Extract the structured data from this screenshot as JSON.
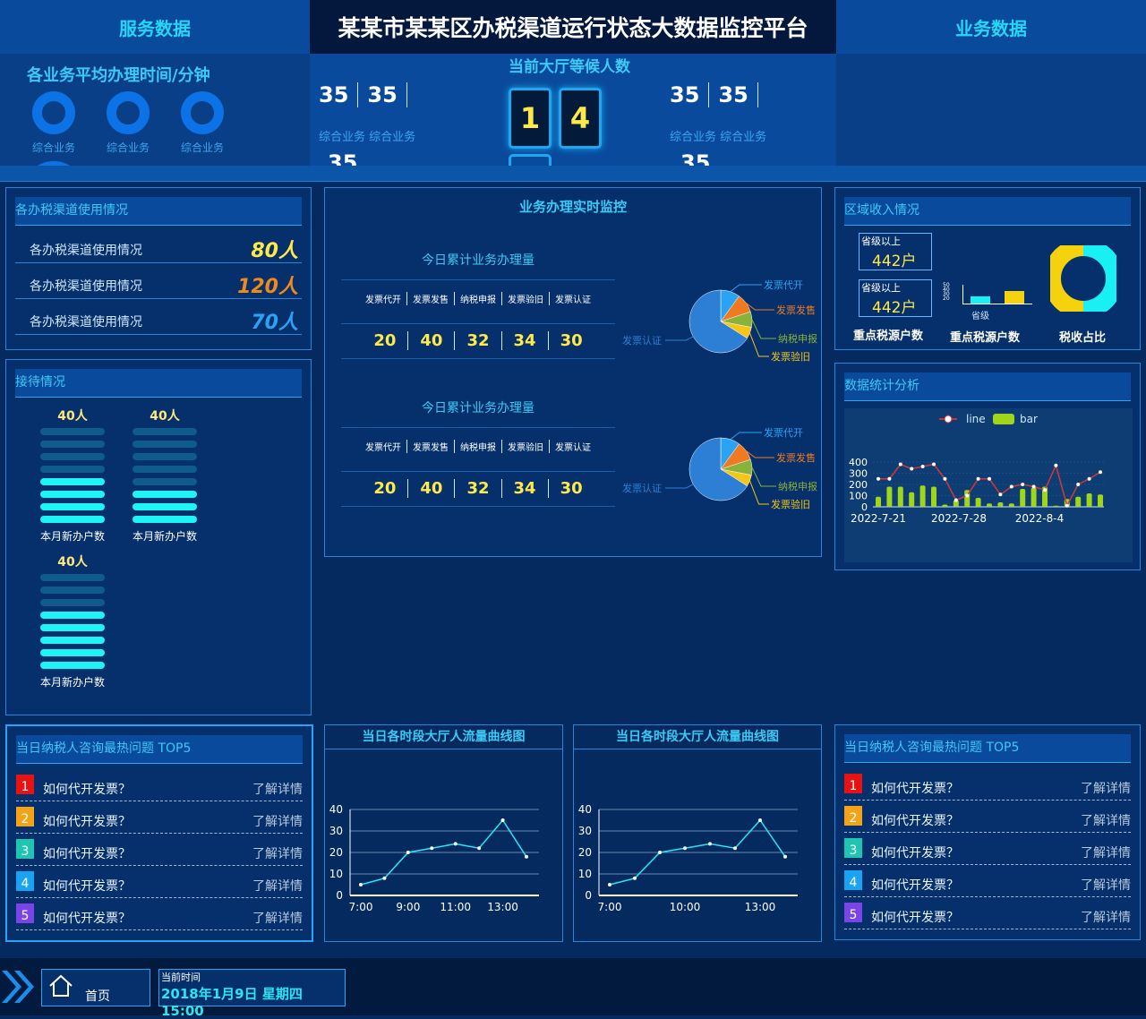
{
  "header": {
    "left": "服务数据",
    "center": "某某市某某区办税渠道运行状态大数据监控平台",
    "right": "业务数据"
  },
  "topband": {
    "avg_title": "各业务平均办理时间/分钟",
    "ring_labels": [
      "综合业务",
      "综合业务",
      "综合业务"
    ],
    "wait_title": "当前大厅等候人数",
    "wait_digits": [
      "1",
      "4"
    ],
    "left_nums": [
      "35",
      "35"
    ],
    "right_nums": [
      "35",
      "35"
    ],
    "left_labels": "综合业务 综合业务",
    "right_labels": "综合业务 综合业务",
    "left_partial": "35",
    "right_partial": "35"
  },
  "channel": {
    "title": "各办税渠道使用情况",
    "rows": [
      {
        "label": "各办税渠道使用情况",
        "value": "80人",
        "color": "#ffe84a"
      },
      {
        "label": "各办税渠道使用情况",
        "value": "120人",
        "color": "#f08a1c"
      },
      {
        "label": "各办税渠道使用情况",
        "value": "70人",
        "color": "#2aa3f5"
      }
    ]
  },
  "reception": {
    "title": "接待情况",
    "items": [
      {
        "count": "40人",
        "label": "本月新办户数",
        "level": 0.5
      },
      {
        "count": "40人",
        "label": "本月新办户数",
        "level": 0.375
      },
      {
        "count": "40人",
        "label": "本月新办户数",
        "level": 0.625
      }
    ]
  },
  "monitor": {
    "title": "业务办理实时监控",
    "blocks": [
      {
        "subtitle": "今日累计业务办理量",
        "cols": [
          "发票代开",
          "发票发售",
          "纳税申报",
          "发票验旧",
          "发票认证"
        ],
        "vals": [
          "20",
          "40",
          "32",
          "34",
          "30"
        ]
      },
      {
        "subtitle": "今日累计业务办理量",
        "cols": [
          "发票代开",
          "发票发售",
          "纳税申报",
          "发票验旧",
          "发票认证"
        ],
        "vals": [
          "20",
          "40",
          "32",
          "34",
          "30"
        ]
      }
    ],
    "pie_labels": [
      "发票代开",
      "发票发售",
      "纳税申报",
      "发票验旧",
      "发票认证"
    ],
    "pie_colors": [
      "#2aa3f5",
      "#f07a22",
      "#88b23a",
      "#f5c518",
      "#2c7fd4"
    ]
  },
  "region": {
    "title": "区域收入情况",
    "box1_label": "省级以上",
    "box1_value": "442户",
    "box2_label": "省级以上",
    "box2_value": "442户",
    "mini_axis": [
      "50",
      "40",
      "30",
      "20"
    ],
    "mini_xlabel": "省级",
    "cap1": "重点税源户数",
    "cap2": "重点税源户数",
    "cap3": "税收占比",
    "donut": {
      "yellow": 0.5,
      "cyan": 0.5
    }
  },
  "stats": {
    "title": "数据统计分析",
    "legend_line": "line",
    "legend_bar": "bar"
  },
  "chart_data": [
    {
      "type": "line",
      "title": "",
      "x": [
        "2022-7-21",
        "2022-7-28",
        "2022-8-4"
      ],
      "series": [
        {
          "name": "line",
          "values": [
            250,
            250,
            380,
            340,
            360,
            380,
            250,
            60,
            100,
            250,
            250,
            110,
            180,
            200,
            180,
            150,
            370,
            10,
            200,
            250,
            310
          ]
        },
        {
          "name": "bar",
          "values": [
            90,
            180,
            180,
            130,
            190,
            180,
            20,
            60,
            150,
            80,
            30,
            40,
            30,
            160,
            170,
            180,
            10,
            70,
            90,
            120,
            110
          ]
        }
      ],
      "ylim": [
        0,
        400
      ],
      "yticks": [
        0,
        100,
        200,
        300,
        400
      ]
    },
    {
      "type": "line",
      "title": "当日各时段大厅人流量曲线图",
      "x": [
        "7:00",
        "9:00",
        "11:00",
        "13:00"
      ],
      "y": [
        5,
        8,
        20,
        22,
        24,
        22,
        35,
        18
      ],
      "ylim": [
        0,
        40
      ],
      "yticks": [
        0,
        10,
        20,
        30,
        40
      ]
    },
    {
      "type": "line",
      "title": "当日各时段大厅人流量曲线图",
      "x": [
        "7:00",
        "10:00",
        "13:00"
      ],
      "y": [
        5,
        8,
        20,
        22,
        24,
        22,
        35,
        18
      ],
      "ylim": [
        0,
        40
      ],
      "yticks": [
        0,
        10,
        20,
        30,
        40
      ]
    }
  ],
  "top5_left": {
    "title": "当日纳税人咨询最热问题 TOP5",
    "items": [
      {
        "n": "1",
        "q": "如何代开发票？",
        "link": "了解详情",
        "color": "#e81212"
      },
      {
        "n": "2",
        "q": "如何代开发票？",
        "link": "了解详情",
        "color": "#f5a316"
      },
      {
        "n": "3",
        "q": "如何代开发票？",
        "link": "了解详情",
        "color": "#1ec6b2"
      },
      {
        "n": "4",
        "q": "如何代开发票？",
        "link": "了解详情",
        "color": "#1aa3f0"
      },
      {
        "n": "5",
        "q": "如何代开发票？",
        "link": "了解详情",
        "color": "#7a44e6"
      }
    ]
  },
  "top5_right": {
    "title": "当日纳税人咨询最热问题 TOP5",
    "items": [
      {
        "n": "1",
        "q": "如何代开发票？",
        "link": "了解详情",
        "color": "#e81212"
      },
      {
        "n": "2",
        "q": "如何代开发票？",
        "link": "了解详情",
        "color": "#f5a316"
      },
      {
        "n": "3",
        "q": "如何代开发票？",
        "link": "了解详情",
        "color": "#1ec6b2"
      },
      {
        "n": "4",
        "q": "如何代开发票？",
        "link": "了解详情",
        "color": "#1aa3f0"
      },
      {
        "n": "5",
        "q": "如何代开发票？",
        "link": "了解详情",
        "color": "#7a44e6"
      }
    ]
  },
  "footer": {
    "home": "首页",
    "time_label": "当前时间",
    "time_value": "2018年1月9日 星期四 15:00"
  }
}
